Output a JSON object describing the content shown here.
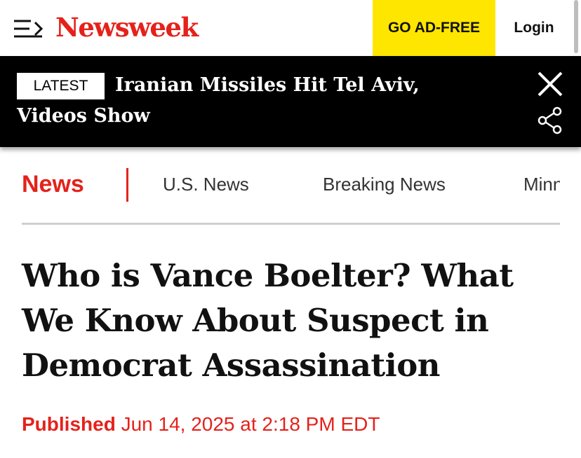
{
  "header": {
    "logo_text": "Newsweek",
    "ad_free_label": "GO AD-FREE",
    "login_label": "Login",
    "brand_color": "#e4221b",
    "ad_free_color": "#ffe600"
  },
  "latest": {
    "badge": "LATEST",
    "headline": "Iranian Missiles Hit Tel Aviv, Videos Show",
    "close_icon": "close-icon",
    "share_icon": "share-icon"
  },
  "nav": {
    "active": "News",
    "items": [
      "U.S. News",
      "Breaking News",
      "Minn"
    ]
  },
  "article": {
    "title": "Who is Vance Boelter? What We Know About Suspect in Democrat Assassination",
    "published_label": "Published",
    "published_date": "Jun 14, 2025 at 2:18 PM EDT"
  }
}
